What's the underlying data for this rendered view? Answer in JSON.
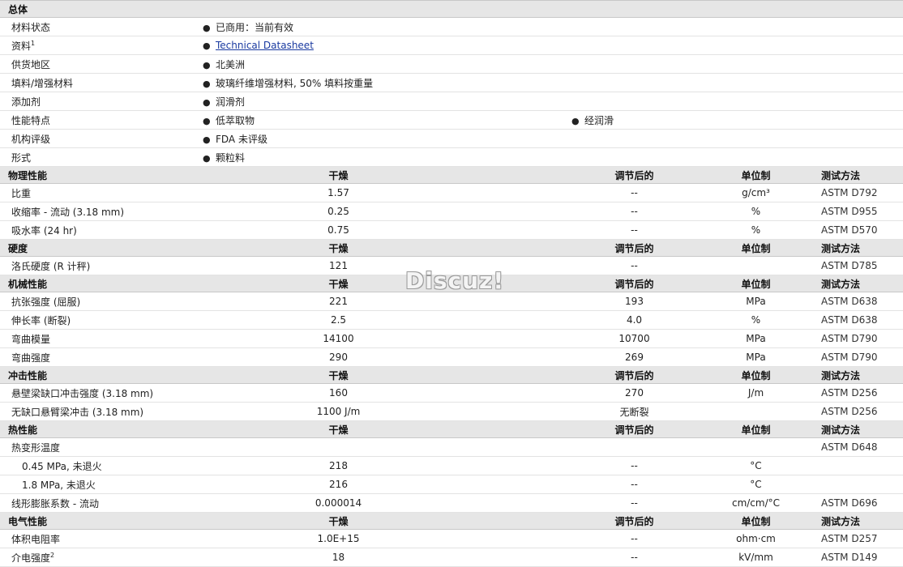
{
  "general": {
    "title": "总体",
    "rows": [
      {
        "label": "材料状态",
        "values": [
          "已商用：当前有效"
        ]
      },
      {
        "label": "资料",
        "sup": "1",
        "values": [
          "Technical Datasheet"
        ]
      },
      {
        "label": "供货地区",
        "values": [
          "北美洲"
        ]
      },
      {
        "label": "填料/增强材料",
        "values": [
          "玻璃纤维增强材料, 50% 填料按重量"
        ]
      },
      {
        "label": "添加剂",
        "values": [
          "润滑剂"
        ]
      },
      {
        "label": "性能特点",
        "values": [
          "低萃取物",
          "经润滑"
        ]
      },
      {
        "label": "机构评级",
        "values": [
          "FDA 未评级"
        ]
      },
      {
        "label": "形式",
        "values": [
          "颗粒料"
        ]
      }
    ]
  },
  "column_headers": {
    "dry": "干燥",
    "conditioned": "调节后的",
    "unit": "单位制",
    "method": "测试方法"
  },
  "sections": [
    {
      "title": "物理性能",
      "rows": [
        {
          "label": "比重",
          "dry": "1.57",
          "cond": "--",
          "unit": "g/cm³",
          "method": "ASTM D792"
        },
        {
          "label": "收缩率  - 流动  (3.18 mm)",
          "dry": "0.25",
          "cond": "--",
          "unit": "%",
          "method": "ASTM D955"
        },
        {
          "label": "吸水率  (24 hr)",
          "dry": "0.75",
          "cond": "--",
          "unit": "%",
          "method": "ASTM D570"
        }
      ]
    },
    {
      "title": "硬度",
      "rows": [
        {
          "label": "洛氏硬度  (R 计秤)",
          "dry": "121",
          "cond": "--",
          "unit": "",
          "method": "ASTM D785"
        }
      ]
    },
    {
      "title": "机械性能",
      "rows": [
        {
          "label": "抗张强度  (屈服)",
          "dry": "221",
          "cond": "193",
          "unit": "MPa",
          "method": "ASTM D638"
        },
        {
          "label": "伸长率  (断裂)",
          "dry": "2.5",
          "cond": "4.0",
          "unit": "%",
          "method": "ASTM D638"
        },
        {
          "label": "弯曲模量",
          "dry": "14100",
          "cond": "10700",
          "unit": "MPa",
          "method": "ASTM D790"
        },
        {
          "label": "弯曲强度",
          "dry": "290",
          "cond": "269",
          "unit": "MPa",
          "method": "ASTM D790"
        }
      ]
    },
    {
      "title": "冲击性能",
      "rows": [
        {
          "label": "悬壁梁缺口冲击强度  (3.18 mm)",
          "dry": "160",
          "cond": "270",
          "unit": "J/m",
          "method": "ASTM D256"
        },
        {
          "label": "无缺口悬臂梁冲击  (3.18 mm)",
          "dry": "1100 J/m",
          "cond": "无断裂",
          "unit": "",
          "method": "ASTM D256"
        }
      ]
    },
    {
      "title": "热性能",
      "rows": [
        {
          "label": "热变形温度",
          "dry": "",
          "cond": "",
          "unit": "",
          "method": "ASTM D648"
        },
        {
          "label": "0.45 MPa, 未退火",
          "sub": true,
          "dry": "218",
          "cond": "--",
          "unit": "°C",
          "method": ""
        },
        {
          "label": "1.8 MPa, 未退火",
          "sub": true,
          "dry": "216",
          "cond": "--",
          "unit": "°C",
          "method": ""
        },
        {
          "label": "线形膨胀系数  - 流动",
          "dry": "0.000014",
          "cond": "--",
          "unit": "cm/cm/°C",
          "method": "ASTM D696"
        }
      ]
    },
    {
      "title": "电气性能",
      "rows": [
        {
          "label": "体积电阻率",
          "dry": "1.0E+15",
          "cond": "--",
          "unit": "ohm·cm",
          "method": "ASTM D257"
        },
        {
          "label": "介电强度",
          "sup": "2",
          "dry": "18",
          "cond": "--",
          "unit": "kV/mm",
          "method": "ASTM D149"
        }
      ]
    }
  ],
  "watermark": "Discuz!",
  "colors": {
    "section_bg": "#e6e6e6",
    "link": "#1a3aa0"
  }
}
